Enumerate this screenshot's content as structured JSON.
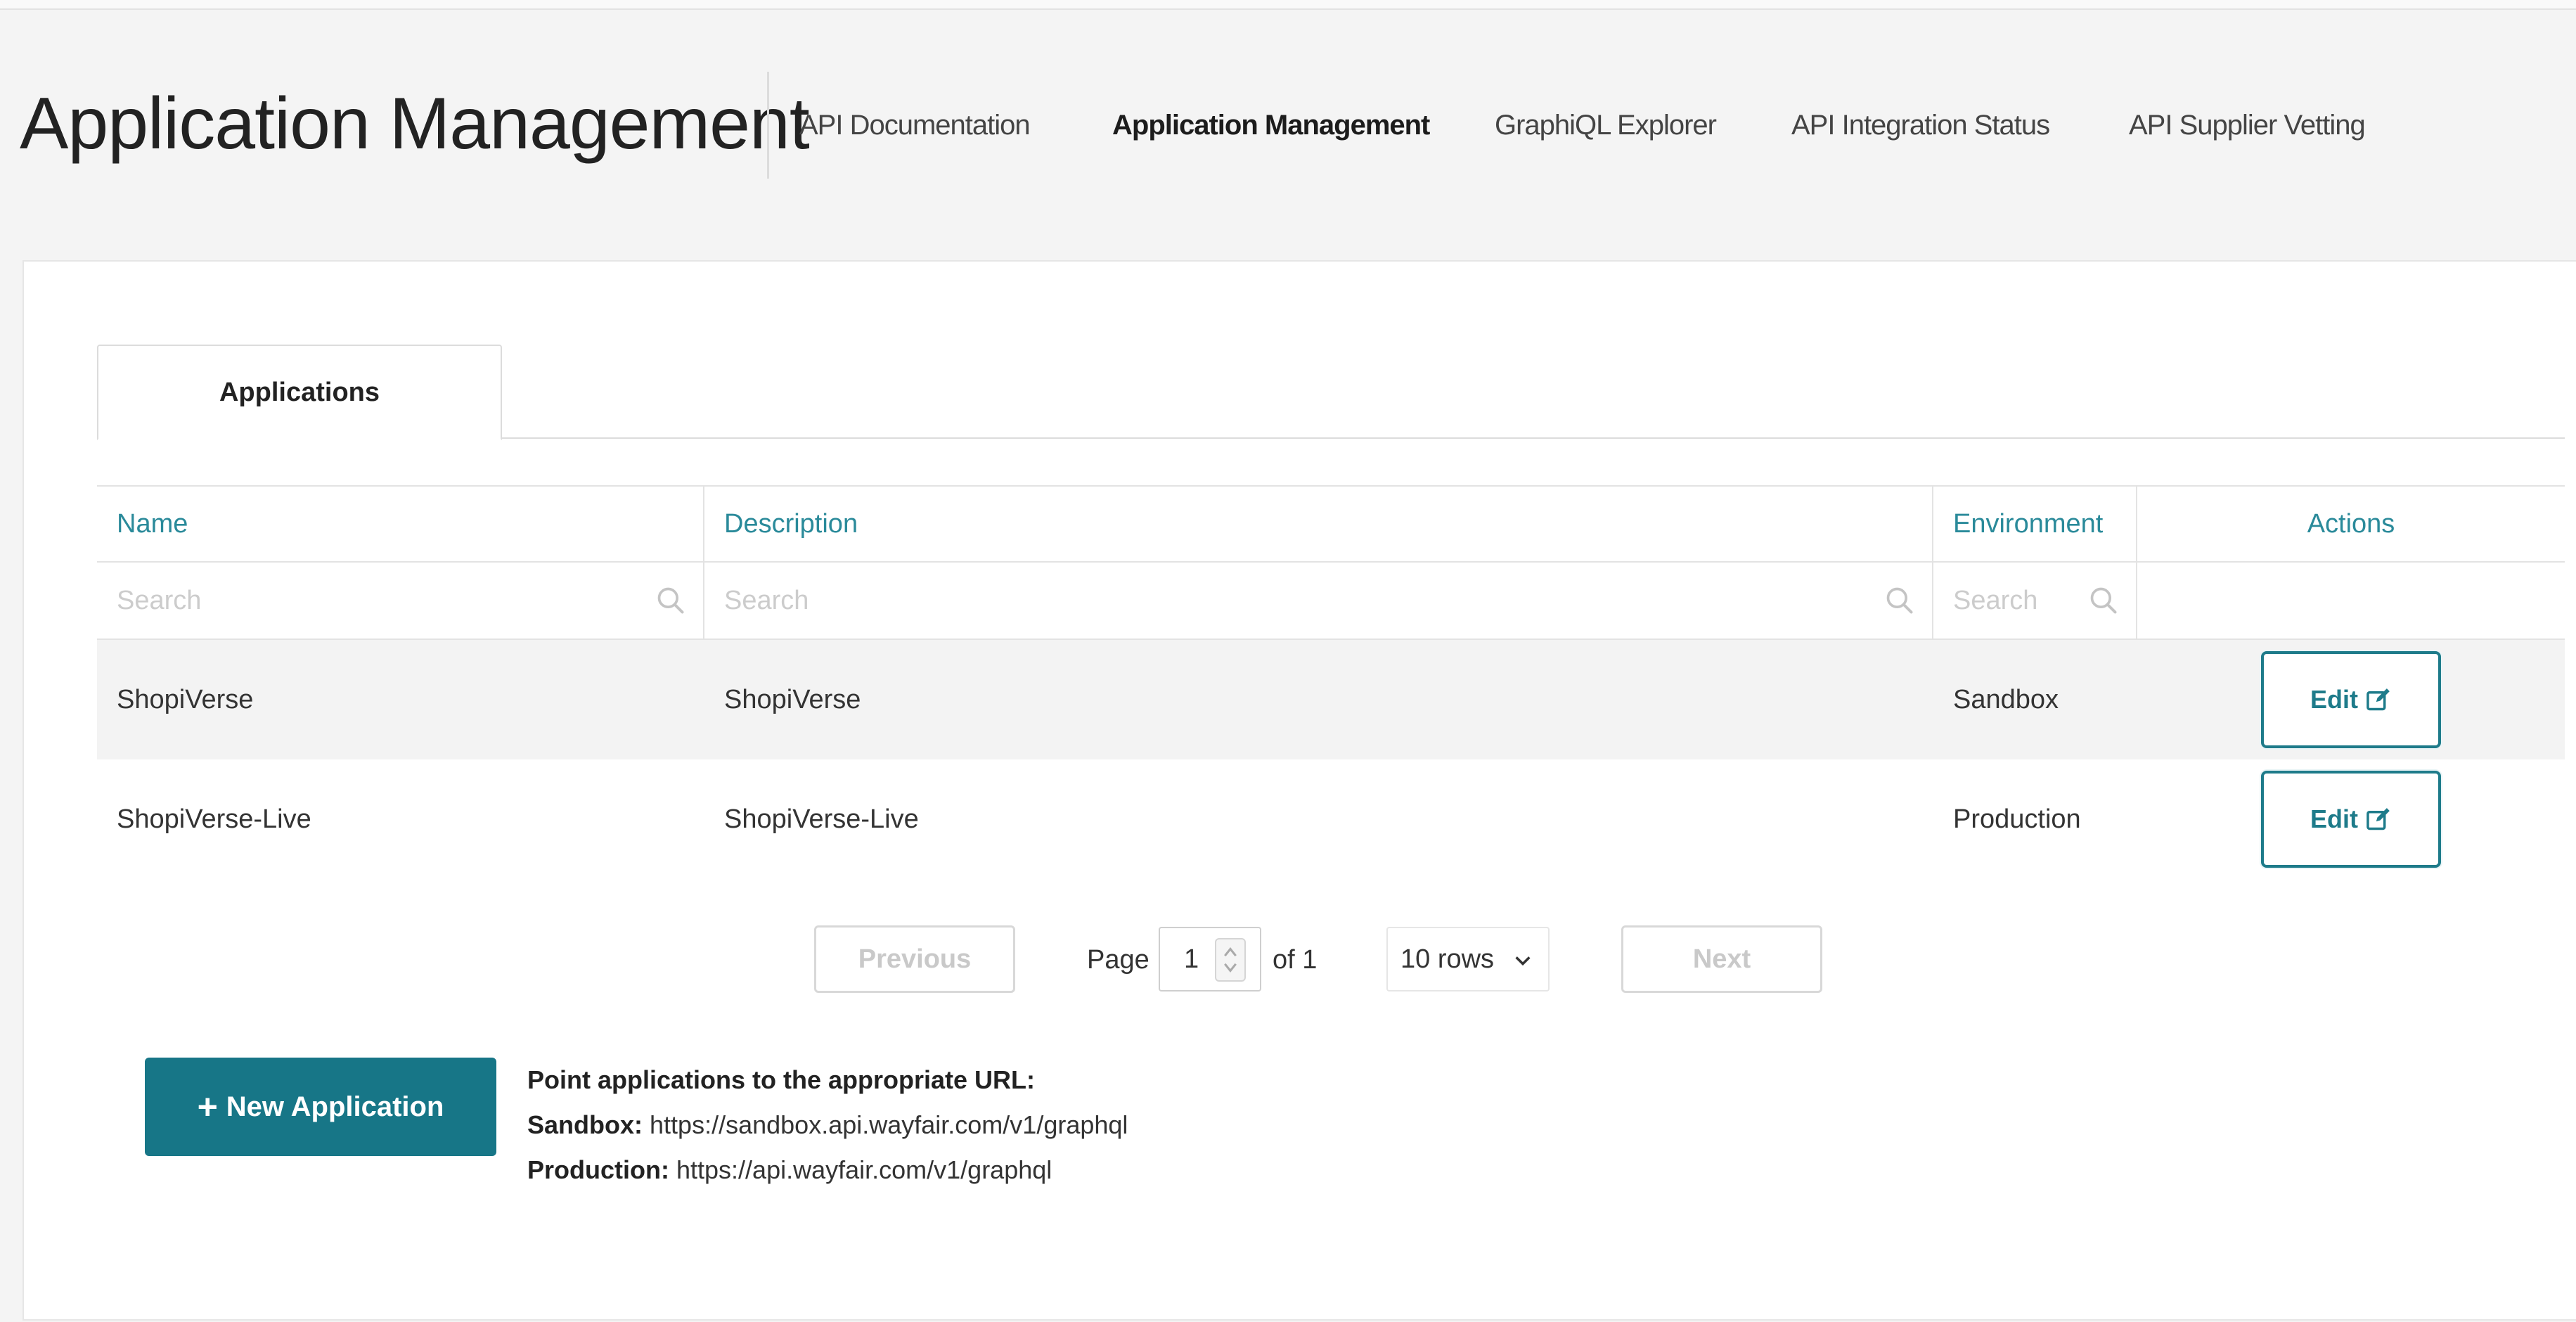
{
  "header": {
    "title": "Application Management",
    "nav": [
      {
        "label": "API Documentation",
        "active": false
      },
      {
        "label": "Application Management",
        "active": true
      },
      {
        "label": "GraphiQL Explorer",
        "active": false
      },
      {
        "label": "API Integration Status",
        "active": false
      },
      {
        "label": "API Supplier Vetting",
        "active": false
      }
    ]
  },
  "tabs": [
    {
      "label": "Applications",
      "active": true
    }
  ],
  "table": {
    "columns": [
      "Name",
      "Description",
      "Environment",
      "Actions"
    ],
    "filters": {
      "name_placeholder": "Search",
      "description_placeholder": "Search",
      "environment_placeholder": "Search"
    },
    "rows": [
      {
        "name": "ShopiVerse",
        "description": "ShopiVerse",
        "environment": "Sandbox",
        "action": "Edit"
      },
      {
        "name": "ShopiVerse-Live",
        "description": "ShopiVerse-Live",
        "environment": "Production",
        "action": "Edit"
      }
    ]
  },
  "pagination": {
    "previous_label": "Previous",
    "page_label": "Page",
    "current_page": "1",
    "of_label": "of 1",
    "rows_option": "10 rows",
    "next_label": "Next"
  },
  "footer": {
    "new_app_label": "New Application",
    "info_heading": "Point applications to the appropriate URL:",
    "sandbox_label": "Sandbox:",
    "sandbox_url": "https://sandbox.api.wayfair.com/v1/graphql",
    "production_label": "Production:",
    "production_url": "https://api.wayfair.com/v1/graphql"
  },
  "colors": {
    "accent": "#177687",
    "header_link": "#2a8a9a",
    "page_bg": "#f4f4f4"
  },
  "icons": [
    "search-icon",
    "edit-icon",
    "chevron-down-icon",
    "stepper-icon",
    "plus-icon"
  ]
}
